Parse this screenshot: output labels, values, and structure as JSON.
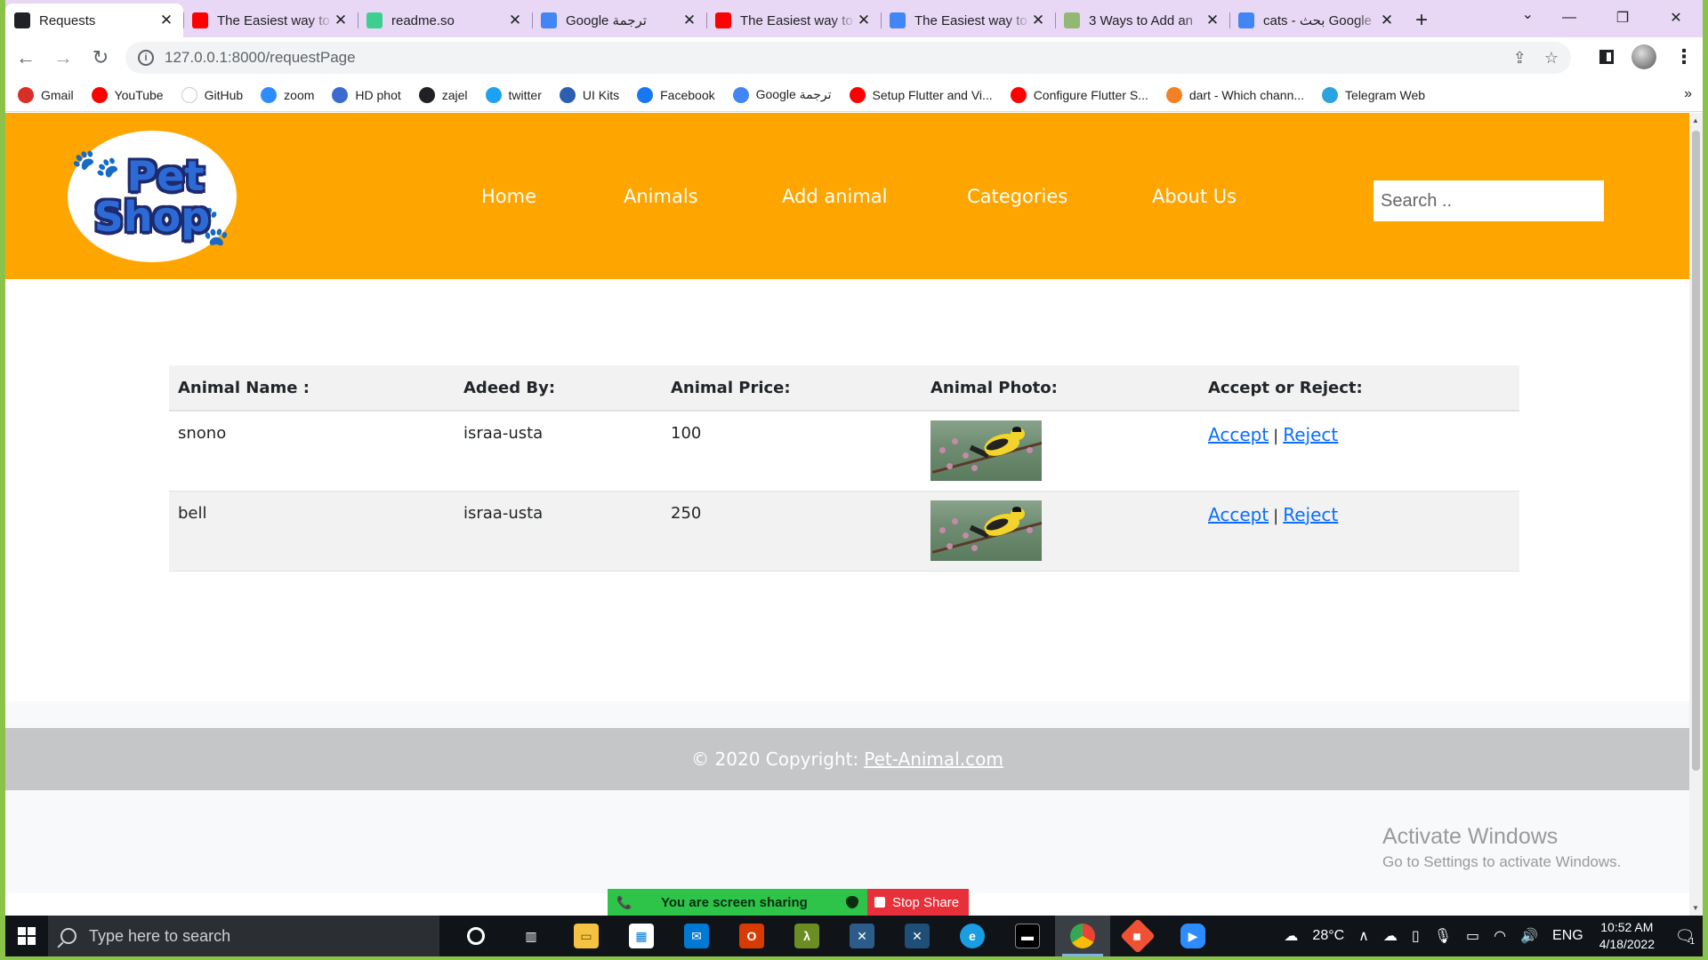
{
  "browser": {
    "tabs": [
      {
        "title": "Requests",
        "icon": "globe-icon",
        "color": "#202124",
        "active": true
      },
      {
        "title": "The Easiest way to",
        "icon": "youtube-icon",
        "color": "#ff0000",
        "active": false
      },
      {
        "title": "readme.so",
        "icon": "readme-icon",
        "color": "#3ecf8e",
        "active": false
      },
      {
        "title": "Google ترجمة",
        "icon": "translate-icon",
        "color": "#4285f4",
        "active": false
      },
      {
        "title": "The Easiest way to",
        "icon": "youtube-icon",
        "color": "#ff0000",
        "active": false
      },
      {
        "title": "The Easiest way to",
        "icon": "google-icon",
        "color": "#4285f4",
        "active": false
      },
      {
        "title": "3 Ways to Add an",
        "icon": "wikihow-icon",
        "color": "#93b874",
        "active": false
      },
      {
        "title": "cats - بحث Google",
        "icon": "google-icon",
        "color": "#4285f4",
        "active": false
      }
    ],
    "new_tab": "+",
    "url": "127.0.0.1:8000/requestPage",
    "bookmarks": [
      {
        "label": "Gmail",
        "icon": "gmail-icon",
        "color": "#d93025"
      },
      {
        "label": "YouTube",
        "icon": "youtube-icon",
        "color": "#ff0000"
      },
      {
        "label": "GitHub",
        "icon": "github-icon",
        "color": "#ffffff"
      },
      {
        "label": "zoom",
        "icon": "zoom-icon",
        "color": "#2d8cff"
      },
      {
        "label": "HD phot",
        "icon": "hd-photo-icon",
        "color": "#3b6bd1"
      },
      {
        "label": "zajel",
        "icon": "globe-icon",
        "color": "#202124"
      },
      {
        "label": "twitter",
        "icon": "twitter-icon",
        "color": "#1da1f2"
      },
      {
        "label": "UI Kits",
        "icon": "uikits-icon",
        "color": "#2c5fb0"
      },
      {
        "label": "Facebook",
        "icon": "facebook-icon",
        "color": "#1877f2"
      },
      {
        "label": "Google ترجمة",
        "icon": "translate-icon",
        "color": "#4285f4"
      },
      {
        "label": "Setup Flutter and Vi...",
        "icon": "youtube-icon",
        "color": "#ff0000"
      },
      {
        "label": "Configure Flutter S...",
        "icon": "youtube-icon",
        "color": "#ff0000"
      },
      {
        "label": "dart - Which chann...",
        "icon": "stackoverflow-icon",
        "color": "#f48024"
      },
      {
        "label": "Telegram Web",
        "icon": "telegram-icon",
        "color": "#2aa3de"
      }
    ],
    "bookmarks_more": "»"
  },
  "site": {
    "logo_line1": "Pet",
    "logo_line2": "Shop",
    "nav": [
      "Home",
      "Animals",
      "Add animal",
      "Categories",
      "About Us"
    ],
    "search_placeholder": "Search ..",
    "brand_color": "#ffa500"
  },
  "table": {
    "headers": [
      "Animal Name :",
      "Adeed By:",
      "Animal Price:",
      "Animal Photo:",
      "Accept or Reject:"
    ],
    "rows": [
      {
        "name": "snono",
        "added_by": "israa-usta",
        "price": "100",
        "accept": "Accept",
        "sep": "|",
        "reject": "Reject"
      },
      {
        "name": "bell",
        "added_by": "israa-usta",
        "price": "250",
        "accept": "Accept",
        "sep": "|",
        "reject": "Reject"
      }
    ]
  },
  "footer": {
    "copyright": "© 2020 Copyright:",
    "link": "Pet-Animal.com"
  },
  "watermark": {
    "line1": "Activate Windows",
    "line2": "Go to Settings to activate Windows."
  },
  "sharebar": {
    "status": "You are screen sharing",
    "stop": "Stop Share"
  },
  "taskbar": {
    "search_placeholder": "Type here to search",
    "weather": "28°C",
    "lang": "ENG",
    "time": "10:52 AM",
    "date": "4/18/2022",
    "notifications": "1"
  }
}
